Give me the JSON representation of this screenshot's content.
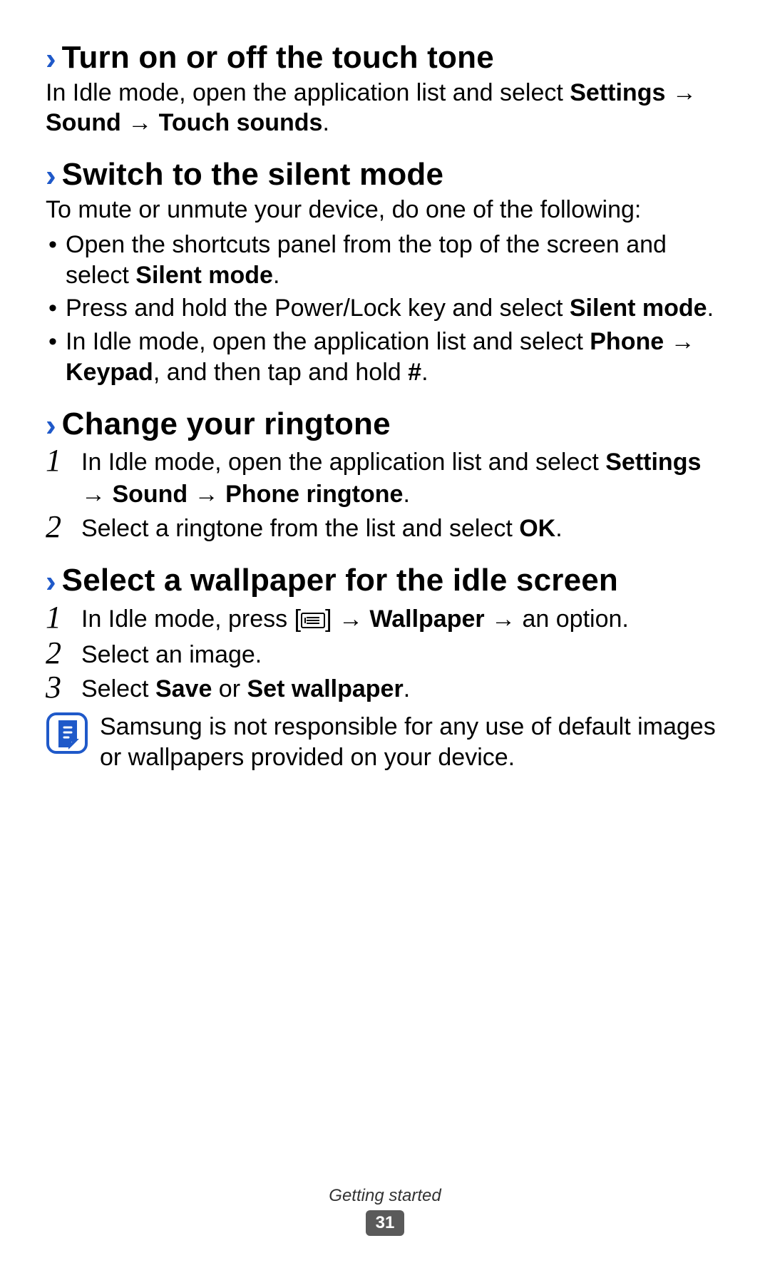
{
  "sections": {
    "touch_tone": {
      "title": "Turn on or off the touch tone",
      "body_pre": "In Idle mode, open the application list and select ",
      "body_bold1": "Settings",
      "arrow1": " → ",
      "body_bold2": "Sound",
      "arrow2": " → ",
      "body_bold3": "Touch sounds",
      "body_end": "."
    },
    "silent": {
      "title": "Switch to the silent mode",
      "intro": "To mute or unmute your device, do one of the following:",
      "b1_pre": "Open the shortcuts panel from the top of the screen and select ",
      "b1_bold": "Silent mode",
      "b1_end": ".",
      "b2_pre": "Press and hold the Power/Lock key and select ",
      "b2_bold": "Silent mode",
      "b2_end": ".",
      "b3_pre": "In Idle mode, open the application list and select ",
      "b3_bold1": "Phone",
      "b3_arrow": " → ",
      "b3_bold2": "Keypad",
      "b3_mid": ", and then tap and hold ",
      "b3_bold3": "#",
      "b3_end": "."
    },
    "ringtone": {
      "title": "Change your ringtone",
      "s1_num": "1",
      "s1_pre": "In Idle mode, open the application list and select ",
      "s1_bold1": "Settings",
      "s1_arrow1": " → ",
      "s1_bold2": "Sound",
      "s1_arrow2": " → ",
      "s1_bold3": "Phone ringtone",
      "s1_end": ".",
      "s2_num": "2",
      "s2_pre": "Select a ringtone from the list and select ",
      "s2_bold": "OK",
      "s2_end": "."
    },
    "wallpaper": {
      "title": "Select a wallpaper for the idle screen",
      "s1_num": "1",
      "s1_pre": "In Idle mode, press [",
      "s1_post_icon": "] → ",
      "s1_bold": "Wallpaper",
      "s1_after": " → an option.",
      "s2_num": "2",
      "s2_text": "Select an image.",
      "s3_num": "3",
      "s3_pre": "Select ",
      "s3_bold1": "Save",
      "s3_mid": " or ",
      "s3_bold2": "Set wallpaper",
      "s3_end": ".",
      "note": "Samsung is not responsible for any use of default images or wallpapers provided on your device."
    }
  },
  "footer": {
    "chapter": "Getting started",
    "page": "31"
  },
  "icons": {
    "chevron": "›",
    "note": "note-icon",
    "menu_key": "menu-key-icon"
  },
  "colors": {
    "accent": "#1f59c9",
    "badge": "#5a5a5a"
  }
}
